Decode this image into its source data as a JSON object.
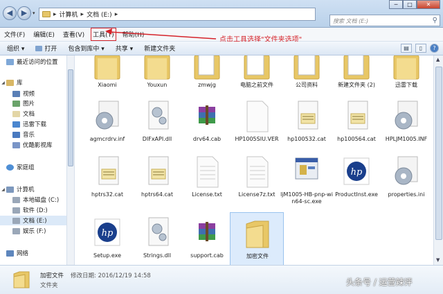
{
  "address": {
    "crumbs": [
      "计算机",
      "文档 (E:)"
    ],
    "search_placeholder": "搜索 文档 (E:)"
  },
  "window_controls": [
    "─",
    "□",
    "✕"
  ],
  "menu": [
    "文件(F)",
    "编辑(E)",
    "查看(V)",
    "工具(T)",
    "帮助(H)"
  ],
  "annotation": "点击工具选择\"文件夹选项\"",
  "commands": [
    "组织 ▾",
    "打开",
    "包含到库中 ▾",
    "共享 ▾",
    "新建文件夹"
  ],
  "nav": {
    "recent": "最近访问的位置",
    "library": "库",
    "library_items": [
      "视频",
      "图片",
      "文档",
      "迅雷下载",
      "音乐",
      "优酷影视库"
    ],
    "homegroup": "家庭组",
    "computer": "计算机",
    "drives": [
      "本地磁盘 (C:)",
      "软件 (D:)",
      "文档 (E:)",
      "娱乐 (F:)"
    ],
    "network": "网络"
  },
  "files": {
    "row0": [
      "Xiaomi",
      "Youxun",
      "zmwjg",
      "电脑之前文件",
      "公司资料",
      "新建文件夹 (2)",
      "迅雷下载"
    ],
    "row1": [
      "agmcrdrv.inf",
      "DIFxAPI.dll",
      "drv64.cab",
      "HP1005SIU.VER",
      "hp100532.cat",
      "hp100564.cat",
      "HPLJM1005.INF"
    ],
    "row2": [
      "hptrs32.cat",
      "hptrs64.cat",
      "License.txt",
      "License7z.txt",
      "ljM1005-HB-pnp-win64-sc.exe",
      "ProductInst.exe",
      "properties.ini"
    ],
    "row3": [
      "Setup.exe",
      "Strings.dll",
      "support.cab",
      "加密文件"
    ]
  },
  "status": {
    "name": "加密文件",
    "modified": "修改日期: 2016/12/19 14:58",
    "type": "文件夹"
  },
  "watermark": "头条号 / 运营辣评",
  "colors": {
    "highlight_red": "#d5232a",
    "folder_yellow": "#e8c766",
    "selection": "#dcebfc"
  }
}
